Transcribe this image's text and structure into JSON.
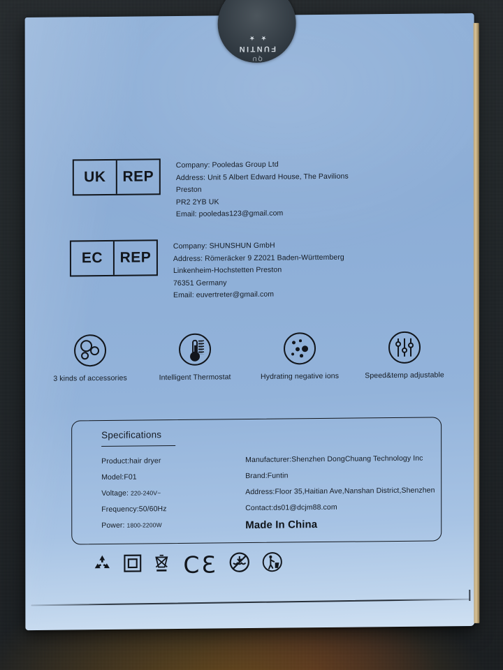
{
  "product_box": {
    "brand_sticker": {
      "brand": "FUNTIN",
      "stars": "★ ★",
      "arc": "QU"
    },
    "uk_rep": {
      "badge_left": "UK",
      "badge_right": "REP",
      "lines": [
        "Company: Pooledas Group Ltd",
        "Address: Unit 5 Albert Edward House, The Pavilions",
        "Preston",
        "PR2 2YB UK",
        "Email: pooledas123@gmail.com"
      ]
    },
    "ec_rep": {
      "badge_left": "EC",
      "badge_right": "REP",
      "lines": [
        "Company: SHUNSHUN GmbH",
        "Address: Römeräcker 9 Z2021 Baden-Württemberg",
        "Linkenheim-Hochstetten Preston",
        "76351 Germany",
        "Email: euvertreter@gmail.com"
      ]
    },
    "features": [
      {
        "icon": "three-circles-accessories-icon",
        "label": "3 kinds of accessories"
      },
      {
        "icon": "thermometer-icon",
        "label": "Intelligent Thermostat"
      },
      {
        "icon": "negative-ions-icon",
        "label": "Hydrating negative ions"
      },
      {
        "icon": "sliders-icon",
        "label": "Speed&temp adjustable"
      }
    ],
    "specifications": {
      "title": "Specifications",
      "left": [
        {
          "label": "Product:hair dryer",
          "value": ""
        },
        {
          "label": "Model:F01",
          "value": ""
        },
        {
          "label": "Voltage: ",
          "value": "220-240V~"
        },
        {
          "label": "Frequency:50/60Hz",
          "value": ""
        },
        {
          "label": "Power: ",
          "value": "1800-2200W"
        }
      ],
      "right": [
        "Manufacturer:Shenzhen DongChuang Technology Inc",
        "Brand:Funtin",
        "Address:Floor 35,Haitian Ave,Nanshan District,Shenzhen",
        "Contact:ds01@dcjm88.com"
      ],
      "made_in": "Made In China"
    },
    "compliance_symbols": [
      "recycling-mobius-icon",
      "double-insulation-class-ii-icon",
      "weee-crossed-out-wheelie-bin-icon",
      "ce-mark-icon",
      "do-not-dispose-in-water-icon",
      "tidyman-bin-icon"
    ],
    "colors": {
      "box_surface": "#8fb0d8",
      "ink": "#12161c",
      "background_fabric": "#1f2427",
      "cardboard_edge": "#d9c396"
    }
  }
}
